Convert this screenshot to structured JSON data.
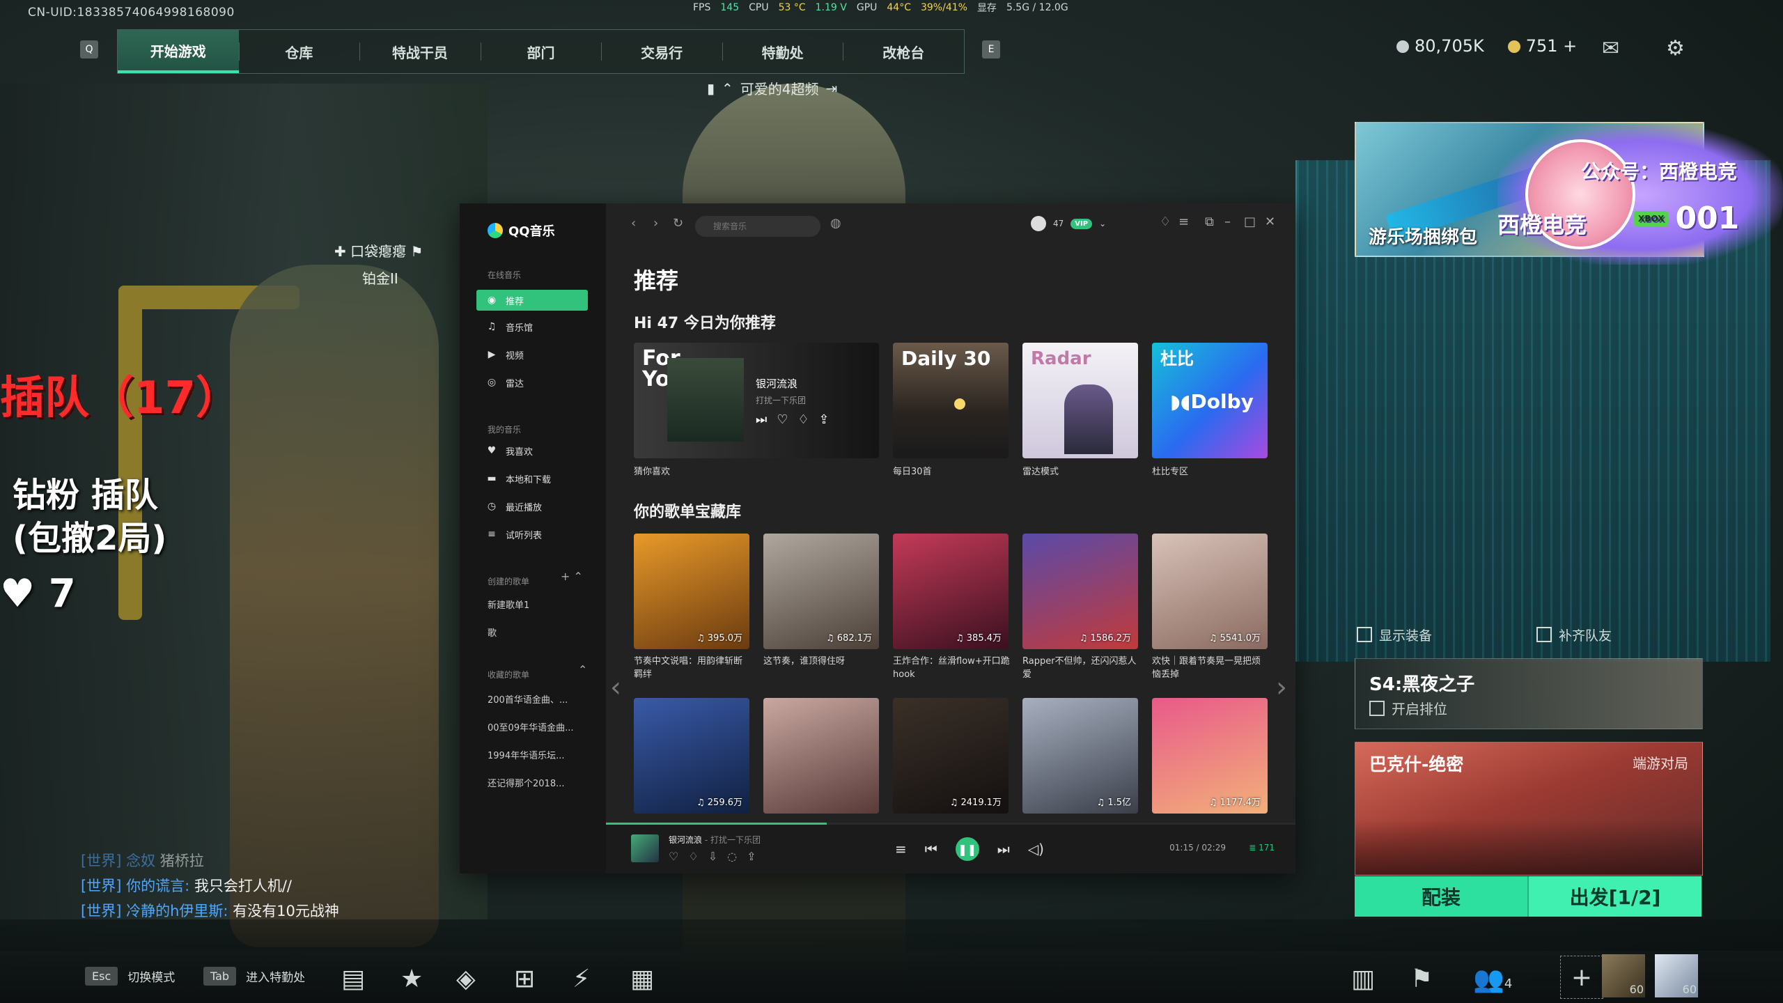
{
  "hud": {
    "uid": "CN-UID:18338574064998168090",
    "perf": {
      "fps_label": "FPS",
      "fps": "145",
      "cpu_label": "CPU",
      "cpu_temp": "53 °C",
      "cpu_volt": "1.19 V",
      "gpu_label": "GPU",
      "gpu_temp": "44°C",
      "gpu_load": "39%/41%",
      "mem_label": "显存",
      "mem": "5.5G / 12.0G"
    },
    "key_left": "Q",
    "key_right": "E",
    "tabs": [
      "开始游戏",
      "仓库",
      "特战干员",
      "部门",
      "交易行",
      "特勤处",
      "改枪台"
    ],
    "squad_name": "可爱的4超频",
    "currency_a": "80,705K",
    "currency_b": "751 +",
    "icons": {
      "mail": "mail-icon",
      "settings": "gear-icon"
    }
  },
  "overlay": {
    "queue": "插队（17）",
    "vip_line1": "钻粉 插队",
    "vip_line2": "(包撤2局)",
    "likes": "♥ 7",
    "marker_name": "口袋瘪瘪",
    "marker_rank": "铂金II"
  },
  "chat": [
    {
      "channel": "[世界]",
      "user": "念奴",
      "text": "猪桥拉",
      "dim": true
    },
    {
      "channel": "[世界]",
      "user": "你的谎言:",
      "text": "我只会打人机//",
      "dim": false
    },
    {
      "channel": "[世界]",
      "user": "冷静的h伊里斯:",
      "text": "有没有10元战神",
      "dim": false
    }
  ],
  "bottom": {
    "esc_key": "Esc",
    "esc_label": "切换模式",
    "tab_key": "Tab",
    "tab_label": "进入特勤处",
    "team_count": "4",
    "level1": "60",
    "level2": "60"
  },
  "right": {
    "banner_label": "游乐场捆绑包",
    "sticker_pub": "公众号：西橙电竞",
    "sticker_brand": "西橙电竞",
    "sticker_num": "001",
    "sticker_badge": "XBOX",
    "check_equip": "显示装备",
    "check_fill": "补齐队友",
    "season_title": "S4:黑夜之子",
    "season_rank": "开启排位",
    "mode_title": "巴克什-绝密",
    "mode_sub": "端游对局",
    "btn_loadout": "配装",
    "btn_go": "出发[1/2]",
    "colors": {
      "accent": "#39e6a8"
    }
  },
  "qq": {
    "app_name": "QQ音乐",
    "sec_online": "在线音乐",
    "nav_online": [
      "推荐",
      "音乐馆",
      "视频",
      "雷达"
    ],
    "sec_mine": "我的音乐",
    "nav_mine": [
      "我喜欢",
      "本地和下载",
      "最近播放",
      "试听列表"
    ],
    "sec_created": "创建的歌单",
    "created": [
      "新建歌单1",
      "歌"
    ],
    "sec_collected": "收藏的歌单",
    "collected": [
      "200首华语金曲、...",
      "00至09年华语金曲...",
      "1994年华语乐坛...",
      "还记得那个2018..."
    ],
    "search_placeholder": "搜索音乐",
    "user_level": "47",
    "vip": "VIP",
    "page_title": "推荐",
    "greeting": "Hi 47 今日为你推荐",
    "for_you": {
      "big": "For You",
      "song": "银河流浪",
      "artist": "打扰一下乐团",
      "caption": "猜你喜欢"
    },
    "recommend": [
      {
        "big": "Daily 30",
        "caption": "每日30首",
        "bg": "#4a3a30"
      },
      {
        "big": "Radar",
        "caption": "雷达模式",
        "bg": "#e8e6ee"
      },
      {
        "big": "杜比",
        "sub": "Dolby",
        "caption": "杜比专区",
        "bg": "#1fa6e6"
      }
    ],
    "library_title": "你的歌单宝藏库",
    "playlists_row1": [
      {
        "plays": "395.0万",
        "caption": "节奏中文说唱：用韵律斩断羁绊",
        "c1": "#e89a2a",
        "c2": "#6a3a10"
      },
      {
        "plays": "682.1万",
        "caption": "这节奏，谁顶得住呀",
        "c1": "#b0a89e",
        "c2": "#4b4038"
      },
      {
        "plays": "385.4万",
        "caption": "王炸合作：丝滑flow+开口跪hook",
        "c1": "#c43a58",
        "c2": "#3a1020"
      },
      {
        "plays": "1586.2万",
        "caption": "Rapper不但帅，还闪闪惹人爱",
        "c1": "#5a4aa8",
        "c2": "#c23a3a"
      },
      {
        "plays": "5541.0万",
        "caption": "欢快｜跟着节奏晃一晃把烦恼丢掉",
        "c1": "#d8c2b8",
        "c2": "#8a6a60"
      }
    ],
    "playlists_row2": [
      {
        "plays": "259.6万",
        "c1": "#3a5aa8",
        "c2": "#102040"
      },
      {
        "plays": "",
        "c1": "#c8a8a0",
        "c2": "#5a3a38"
      },
      {
        "plays": "2419.1万",
        "c1": "#3a3028",
        "c2": "#141010"
      },
      {
        "plays": "1.5亿",
        "c1": "#a8b0c0",
        "c2": "#3a3f4a"
      },
      {
        "plays": "1177.4万",
        "c1": "#e85a8a",
        "c2": "#f2b07a"
      }
    ],
    "player": {
      "song": "银河流浪",
      "artist": "- 打扰一下乐团",
      "time": "01:15 / 02:29",
      "count": "171",
      "progress": 0.32
    }
  }
}
